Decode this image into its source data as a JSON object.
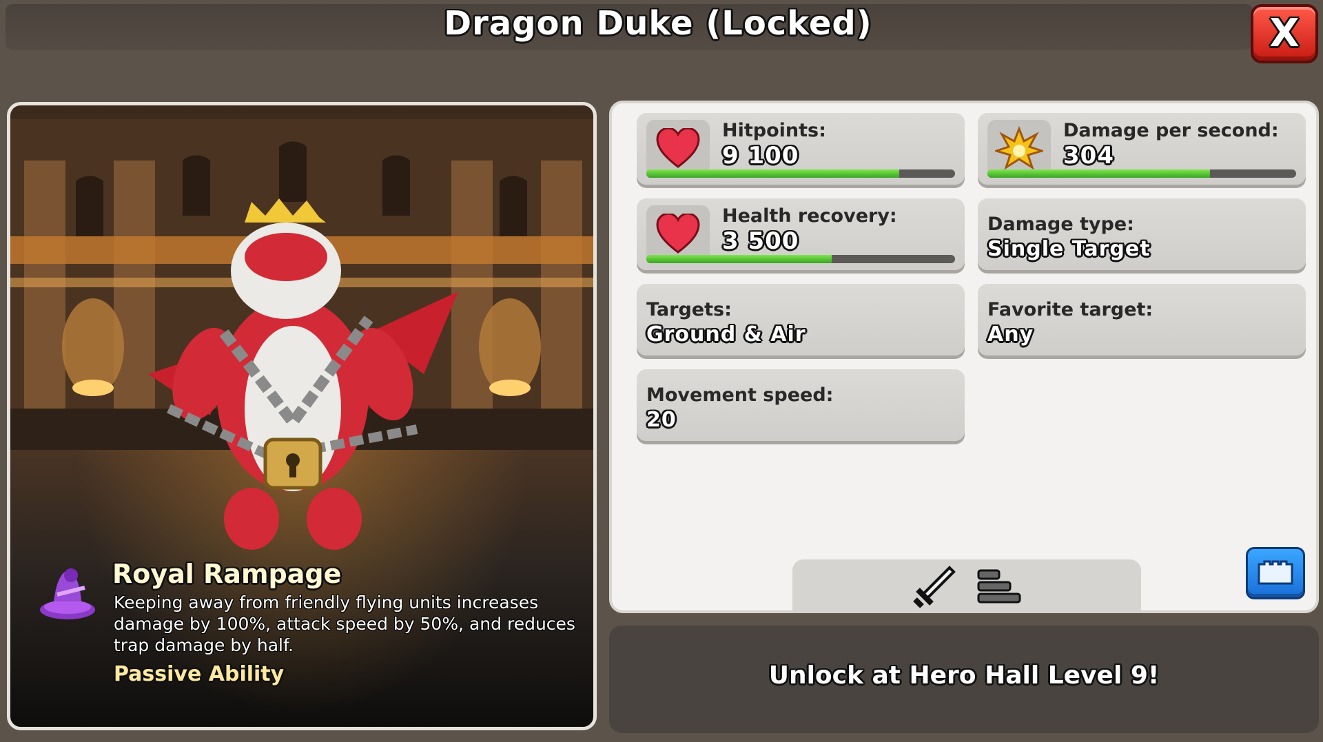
{
  "header": {
    "title": "Dragon Duke (Locked)",
    "close_label": "X"
  },
  "hero": {
    "ability": {
      "name": "Royal Rampage",
      "description": "Keeping away from friendly flying units increases damage by 100%, attack speed by 50%, and reduces trap damage by half.",
      "type": "Passive Ability"
    }
  },
  "stats": {
    "hitpoints": {
      "label": "Hitpoints:",
      "value": "9 100",
      "progress": 0.82
    },
    "dps": {
      "label": "Damage per second:",
      "value": "304",
      "progress": 0.72
    },
    "health_recovery": {
      "label": "Health recovery:",
      "value": "3 500",
      "progress": 0.6
    },
    "damage_type": {
      "label": "Damage type:",
      "value": "Single Target"
    },
    "targets": {
      "label": "Targets:",
      "value": "Ground & Air"
    },
    "favorite_target": {
      "label": "Favorite target:",
      "value": "Any"
    },
    "movement_speed": {
      "label": "Movement speed:",
      "value": "20"
    }
  },
  "tabs": {
    "icons": [
      "sword-icon",
      "stack-icon"
    ]
  },
  "footer": {
    "unlock_text": "Unlock at Hero Hall Level 9!"
  },
  "colors": {
    "accent_green": "#4fc02c",
    "close_red": "#d9261c",
    "heart_red": "#e8334a"
  }
}
